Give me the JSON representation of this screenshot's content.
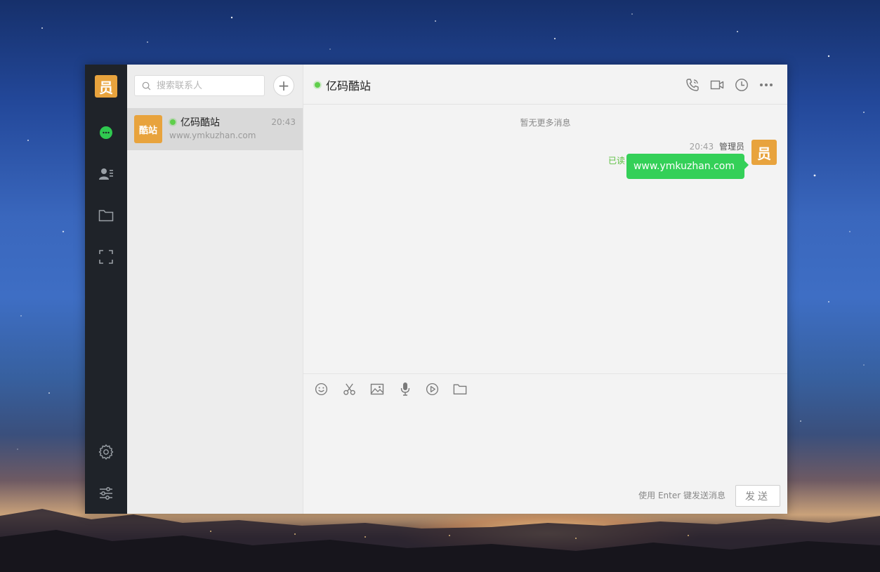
{
  "user": {
    "avatar_text": "员"
  },
  "search": {
    "placeholder": "搜索联系人"
  },
  "add_button": {
    "label": "+"
  },
  "contacts": [
    {
      "avatar_text": "酷站",
      "name": "亿码酷站",
      "time": "20:43",
      "preview": "www.ymkuzhan.com",
      "online": true
    }
  ],
  "chat": {
    "title": "亿码酷站",
    "no_more": "暂无更多消息",
    "messages": [
      {
        "time": "20:43",
        "sender": "管理员",
        "text": "www.ymkuzhan.com",
        "status": "已读",
        "avatar_text": "员"
      }
    ]
  },
  "composer": {
    "hint": "使用 Enter 键发送消息",
    "send_label": "发送"
  },
  "icons": {
    "rail": [
      "chat-bubble-icon",
      "contacts-card-icon",
      "folder-icon",
      "fullscreen-icon",
      "gear-icon",
      "sliders-icon"
    ],
    "header": [
      "phone-icon",
      "video-icon",
      "clock-icon",
      "more-icon"
    ],
    "toolbar": [
      "emoji-icon",
      "scissors-icon",
      "image-icon",
      "microphone-icon",
      "video-play-icon",
      "folder-icon"
    ]
  },
  "colors": {
    "accent_green": "#34d058",
    "online_dot": "#5fcf4b",
    "avatar_orange": "#e8a33d",
    "rail_bg": "#1f2329"
  }
}
